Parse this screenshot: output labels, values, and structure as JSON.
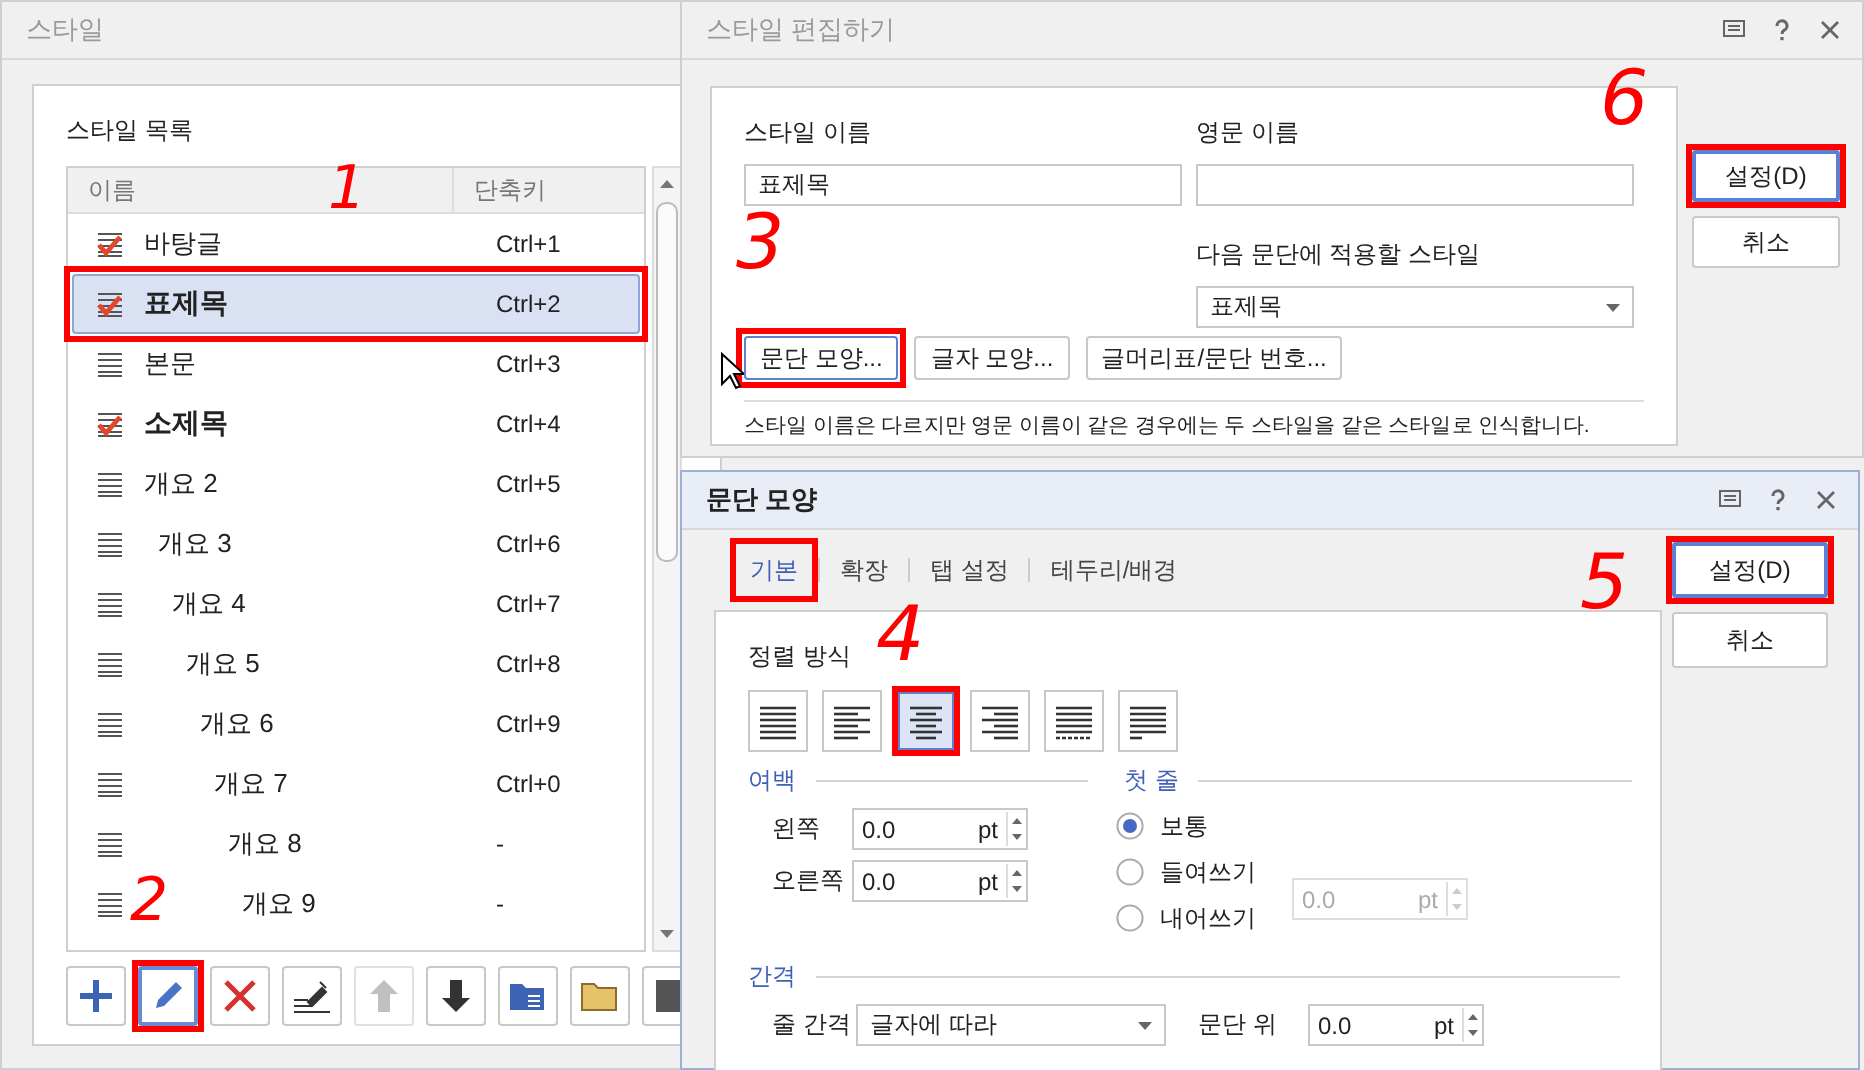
{
  "style_window": {
    "title": "스타일",
    "list_label": "스타일 목록",
    "columns": [
      "이름",
      "단축키"
    ],
    "styles": [
      {
        "name": "바탕글",
        "shortcut": "Ctrl+1",
        "checked": true,
        "bold": false,
        "selected": false
      },
      {
        "name": "표제목",
        "shortcut": "Ctrl+2",
        "checked": true,
        "bold": true,
        "selected": true,
        "highlighted": true
      },
      {
        "name": "본문",
        "shortcut": "Ctrl+3",
        "checked": false,
        "bold": false,
        "selected": false
      },
      {
        "name": "소제목",
        "shortcut": "Ctrl+4",
        "checked": true,
        "bold": true,
        "selected": false
      },
      {
        "name": "개요 2",
        "shortcut": "Ctrl+5",
        "checked": false,
        "bold": false,
        "selected": false,
        "children": [
          {
            "name": "개요 3",
            "shortcut": "Ctrl+6",
            "checked": false,
            "bold": false,
            "selected": false,
            "children": [
              {
                "name": "개요 4",
                "shortcut": "Ctrl+7",
                "checked": false,
                "bold": false,
                "selected": false,
                "children": [
                  {
                    "name": "개요 5",
                    "shortcut": "Ctrl+8",
                    "checked": false,
                    "bold": false,
                    "selected": false,
                    "children": [
                      {
                        "name": "개요 6",
                        "shortcut": "Ctrl+9",
                        "checked": false,
                        "bold": false,
                        "selected": false,
                        "children": [
                          {
                            "name": "개요 7",
                            "shortcut": "Ctrl+0",
                            "checked": false,
                            "bold": false,
                            "selected": false,
                            "children": [
                              {
                                "name": "개요 8",
                                "shortcut": "-",
                                "checked": false,
                                "bold": false,
                                "selected": false,
                                "children": [
                                  {
                                    "name": "개요 9",
                                    "shortcut": "-",
                                    "checked": false,
                                    "bold": false,
                                    "selected": false
                                  }
                                ]
                              }
                            ]
                          }
                        ]
                      }
                    ]
                  }
                ]
              }
            ]
          }
        ]
      }
    ],
    "toolbar": [
      {
        "kind": "add",
        "disabled": false
      },
      {
        "kind": "edit",
        "disabled": false,
        "highlighted": true
      },
      {
        "kind": "delete",
        "disabled": false
      },
      {
        "kind": "eyedropper",
        "disabled": false
      },
      {
        "kind": "up",
        "disabled": true
      },
      {
        "kind": "down",
        "disabled": false
      },
      {
        "kind": "folder-text",
        "disabled": false
      },
      {
        "kind": "folder",
        "disabled": false
      },
      {
        "kind": "save",
        "disabled": false
      }
    ]
  },
  "edit_window": {
    "title": "스타일 편집하기",
    "style_name_label": "스타일 이름",
    "style_name": "표제목",
    "english_name_label": "영문 이름",
    "next_style_label": "다음 문단에 적용할 스타일",
    "next_style": "표제목",
    "buttons": [
      {
        "label": "문단 모양...",
        "highlighted": true,
        "focused": true
      },
      {
        "label": "글자 모양...",
        "focused": false
      },
      {
        "label": "글머리표/문단 번호...",
        "focused": false
      }
    ],
    "note": "스타일 이름은 다르지만 영문 이름이 같은 경우에는 두 스타일을 같은 스타일로 인식합니다.",
    "actions": [
      {
        "label": "설정(D)",
        "default": true,
        "highlighted": true
      },
      {
        "label": "취소",
        "default": false
      }
    ]
  },
  "paragraph_window": {
    "title": "문단 모양",
    "tabs": [
      {
        "label": "기본",
        "selected": true,
        "highlighted": true
      },
      {
        "label": "확장",
        "selected": false
      },
      {
        "label": "탭 설정",
        "selected": false
      },
      {
        "label": "테두리/배경",
        "selected": false
      }
    ],
    "alignment_label": "정렬 방식",
    "alignments": [
      {
        "kind": "justify",
        "selected": false
      },
      {
        "kind": "left",
        "selected": false
      },
      {
        "kind": "center",
        "selected": true,
        "highlighted": true
      },
      {
        "kind": "right",
        "selected": false
      },
      {
        "kind": "distribute",
        "selected": false
      },
      {
        "kind": "divide",
        "selected": false
      }
    ],
    "margin": {
      "title": "여백",
      "fields": [
        {
          "label": "왼쪽",
          "value": "0.0",
          "unit": "pt"
        },
        {
          "label": "오른쪽",
          "value": "0.0",
          "unit": "pt"
        }
      ]
    },
    "first_line": {
      "title": "첫 줄",
      "options": [
        {
          "label": "보통",
          "selected": true
        },
        {
          "label": "들여쓰기",
          "selected": false
        },
        {
          "label": "내어쓰기",
          "selected": false
        }
      ],
      "indent": {
        "value": "0.0",
        "unit": "pt",
        "disabled": true
      }
    },
    "spacing": {
      "title": "간격",
      "line_spacing_label": "줄 간격",
      "line_spacing": "글자에 따라",
      "above_label": "문단 위",
      "above": {
        "value": "0.0",
        "unit": "pt"
      }
    },
    "actions": [
      {
        "label": "설정(D)",
        "default": true,
        "highlighted": true
      },
      {
        "label": "취소",
        "default": false
      }
    ]
  },
  "annotations": [
    "1",
    "2",
    "3",
    "4",
    "5",
    "6"
  ]
}
